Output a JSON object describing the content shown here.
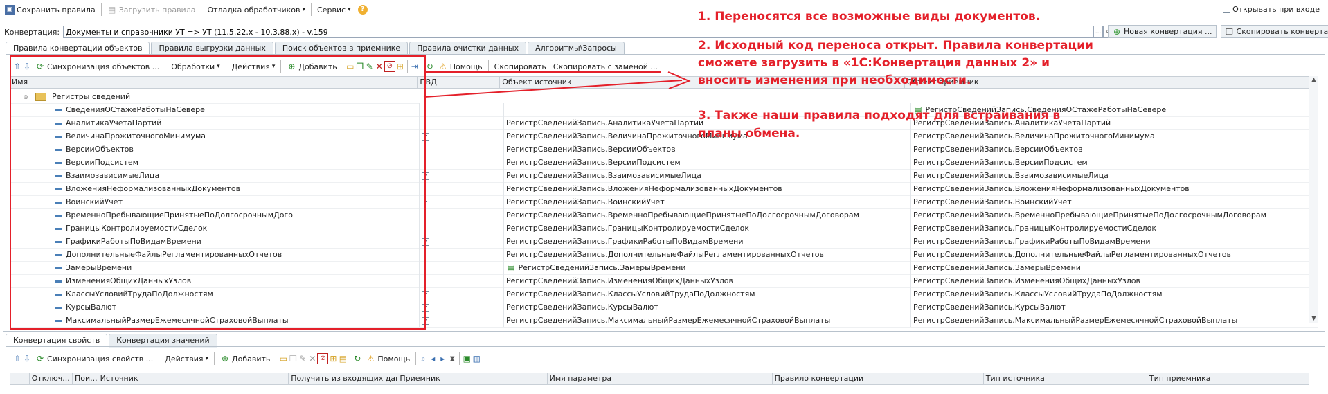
{
  "toolbar": {
    "save_rules": "Сохранить правила",
    "load_rules": "Загрузить правила",
    "debug_handlers": "Отладка обработчиков",
    "service": "Сервис",
    "help": "?",
    "open_on_start": "Открывать при входе"
  },
  "conversion": {
    "label": "Конвертация:",
    "value": "Документы и справочники УТ => УТ (11.5.22.х - 10.3.88.х) - v.159",
    "new_button": "Новая конвертация ...",
    "copy_button": "Скопировать конвертацию"
  },
  "top_tabs": [
    "Правила конвертации объектов",
    "Правила выгрузки данных",
    "Поиск объектов в приемнике",
    "Правила очистки данных",
    "Алгоритмы\\Запросы"
  ],
  "grid_toolbar": {
    "sync": "Синхронизация объектов ...",
    "processing": "Обработки",
    "actions": "Действия",
    "add": "Добавить",
    "help": "Помощь",
    "copy": "Скопировать",
    "copy_replace": "Скопировать с заменой ..."
  },
  "grid_columns": {
    "name": "Имя",
    "pvd": "ПВД",
    "source": "Объект источник",
    "dest": "Объект приемник"
  },
  "group_row": "Регистры сведений",
  "rows": [
    {
      "name": "СведенияОСтажеРаботыНаСевере",
      "pvd": false,
      "src": "",
      "dst": "РегистрСведенийЗапись.СведенияОСтажеРаботыНаСевере",
      "dst_icon": true
    },
    {
      "name": "АналитикаУчетаПартий",
      "pvd": false,
      "src": "РегистрСведенийЗапись.АналитикаУчетаПартий",
      "dst": "РегистрСведенийЗапись.АналитикаУчетаПартий"
    },
    {
      "name": "ВеличинаПрожиточногоМинимума",
      "pvd": true,
      "src": "РегистрСведенийЗапись.ВеличинаПрожиточногоМинимума",
      "dst": "РегистрСведенийЗапись.ВеличинаПрожиточногоМинимума"
    },
    {
      "name": "ВерсииОбъектов",
      "pvd": false,
      "src": "РегистрСведенийЗапись.ВерсииОбъектов",
      "dst": "РегистрСведенийЗапись.ВерсииОбъектов"
    },
    {
      "name": "ВерсииПодсистем",
      "pvd": false,
      "src": "РегистрСведенийЗапись.ВерсииПодсистем",
      "dst": "РегистрСведенийЗапись.ВерсииПодсистем"
    },
    {
      "name": "ВзаимозависимыеЛица",
      "pvd": true,
      "src": "РегистрСведенийЗапись.ВзаимозависимыеЛица",
      "dst": "РегистрСведенийЗапись.ВзаимозависимыеЛица"
    },
    {
      "name": "ВложенияНеформализованныхДокументов",
      "pvd": false,
      "src": "РегистрСведенийЗапись.ВложенияНеформализованныхДокументов",
      "dst": "РегистрСведенийЗапись.ВложенияНеформализованныхДокументов"
    },
    {
      "name": "ВоинскийУчет",
      "pvd": true,
      "src": "РегистрСведенийЗапись.ВоинскийУчет",
      "dst": "РегистрСведенийЗапись.ВоинскийУчет"
    },
    {
      "name": "ВременноПребывающиеПринятыеПоДолгосрочнымДого",
      "pvd": false,
      "src": "РегистрСведенийЗапись.ВременноПребывающиеПринятыеПоДолгосрочнымДоговорам",
      "dst": "РегистрСведенийЗапись.ВременноПребывающиеПринятыеПоДолгосрочнымДоговорам"
    },
    {
      "name": "ГраницыКонтролируемостиСделок",
      "pvd": false,
      "src": "РегистрСведенийЗапись.ГраницыКонтролируемостиСделок",
      "dst": "РегистрСведенийЗапись.ГраницыКонтролируемостиСделок"
    },
    {
      "name": "ГрафикиРаботыПоВидамВремени",
      "pvd": true,
      "src": "РегистрСведенийЗапись.ГрафикиРаботыПоВидамВремени",
      "dst": "РегистрСведенийЗапись.ГрафикиРаботыПоВидамВремени"
    },
    {
      "name": "ДополнительныеФайлыРегламентированныхОтчетов",
      "pvd": false,
      "src": "РегистрСведенийЗапись.ДополнительныеФайлыРегламентированныхОтчетов",
      "dst": "РегистрСведенийЗапись.ДополнительныеФайлыРегламентированныхОтчетов"
    },
    {
      "name": "ЗамерыВремени",
      "pvd": false,
      "src": "РегистрСведенийЗапись.ЗамерыВремени",
      "src_icon": true,
      "dst": "РегистрСведенийЗапись.ЗамерыВремени"
    },
    {
      "name": "ИзмененияОбщихДанныхУзлов",
      "pvd": false,
      "src": "РегистрСведенийЗапись.ИзмененияОбщихДанныхУзлов",
      "dst": "РегистрСведенийЗапись.ИзмененияОбщихДанныхУзлов"
    },
    {
      "name": "КлассыУсловийТрудаПоДолжностям",
      "pvd": true,
      "src": "РегистрСведенийЗапись.КлассыУсловийТрудаПоДолжностям",
      "dst": "РегистрСведенийЗапись.КлассыУсловийТрудаПоДолжностям"
    },
    {
      "name": "КурсыВалют",
      "pvd": true,
      "src": "РегистрСведенийЗапись.КурсыВалют",
      "dst": "РегистрСведенийЗапись.КурсыВалют"
    },
    {
      "name": "МаксимальныйРазмерЕжемесячнойСтраховойВыплаты",
      "pvd": true,
      "src": "РегистрСведенийЗапись.МаксимальныйРазмерЕжемесячнойСтраховойВыплаты",
      "dst": "РегистрСведенийЗапись.МаксимальныйРазмерЕжемесячнойСтраховойВыплаты"
    }
  ],
  "annotations": {
    "line1": "1. Переносятся все возможные виды документов.",
    "line2a": "2. Исходный код переноса открыт. Правила конвертации",
    "line2b": "сможете загрузить в «1С:Конвертация данных 2» и",
    "line2c": "вносить изменения при необходимости.",
    "line3a": "3. Также наши правила подходят для встраивания в",
    "line3b": "планы обмена."
  },
  "bottom_tabs": [
    "Конвертация свойств",
    "Конвертация значений"
  ],
  "bottom_toolbar": {
    "sync": "Синхронизация свойств ...",
    "actions": "Действия",
    "add": "Добавить",
    "help": "Помощь"
  },
  "bottom_columns": [
    "Отключ...",
    "Пои...",
    "Источник",
    "Получить из входящих данн...",
    "Приемник",
    "Имя параметра",
    "Правило конвертации",
    "Тип источника",
    "Тип приемника"
  ],
  "colors": {
    "annotation": "#e4202a",
    "highlight_box": "#e4202a"
  }
}
